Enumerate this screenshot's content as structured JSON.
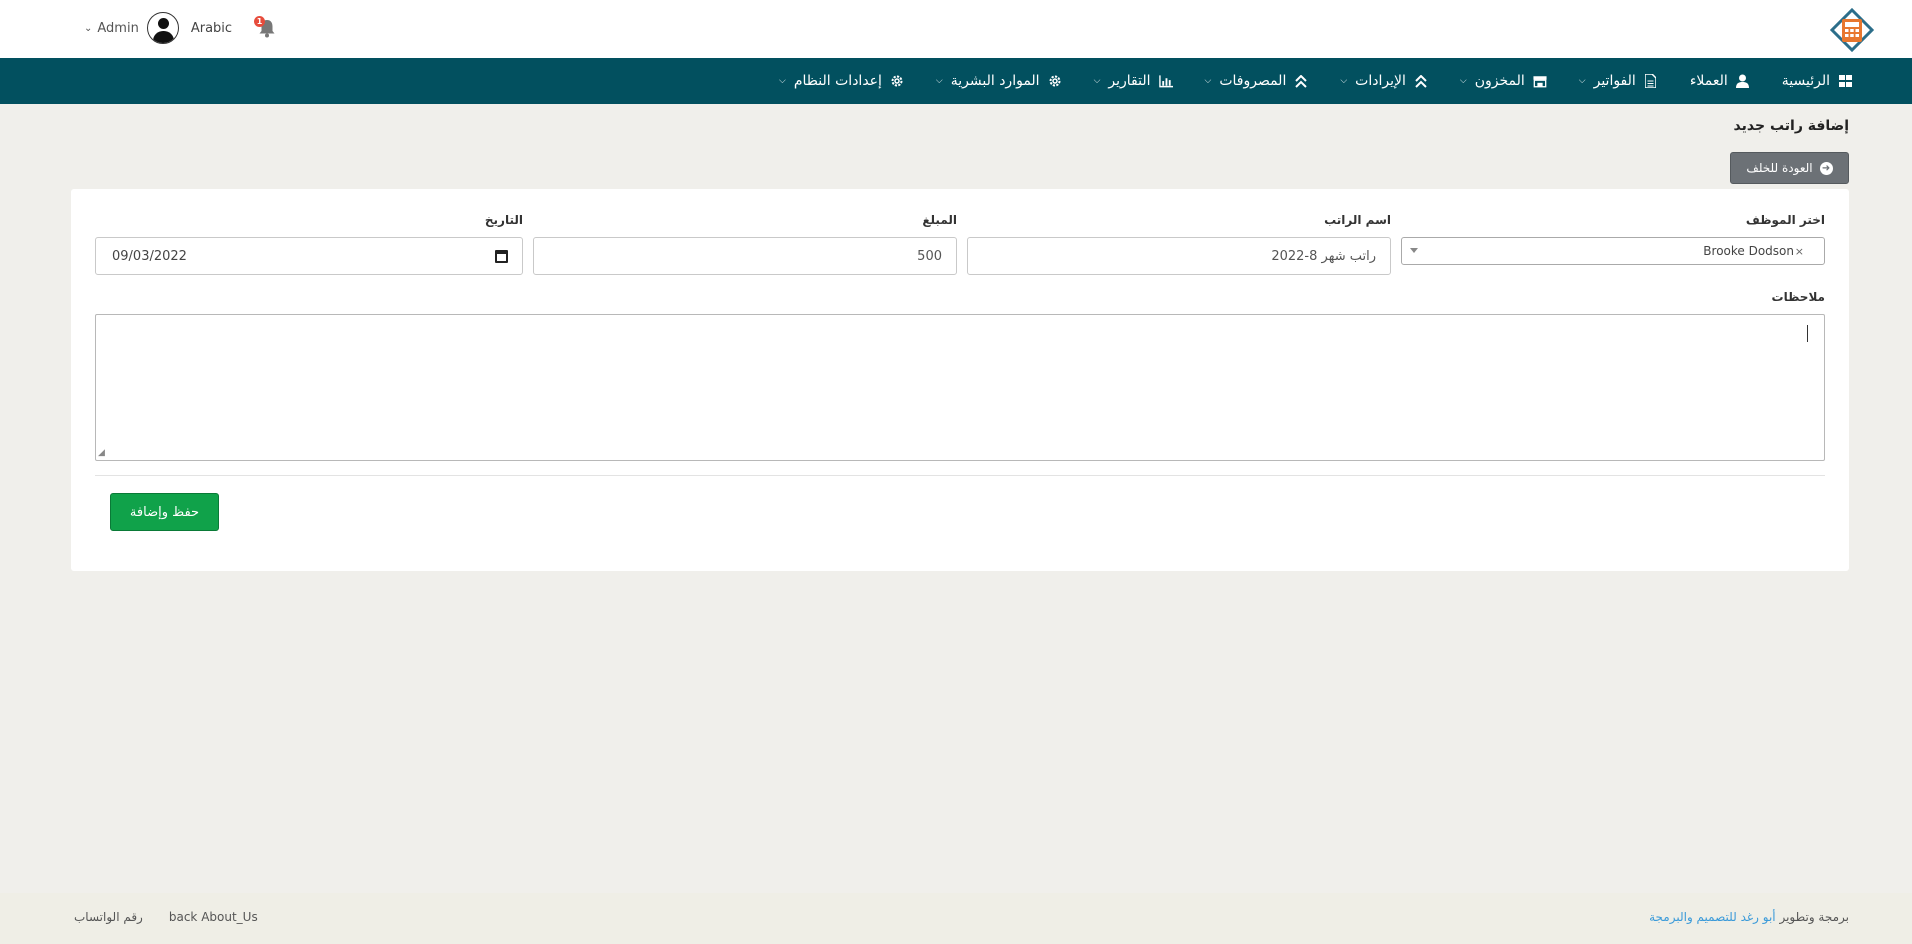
{
  "header": {
    "language": "Arabic",
    "user_name": "Admin",
    "notification_count": "1"
  },
  "nav": [
    {
      "label": "الرئيسية",
      "icon": "dashboard-icon",
      "has_dropdown": false
    },
    {
      "label": "العملاء",
      "icon": "user-icon",
      "has_dropdown": false
    },
    {
      "label": "الفواتير",
      "icon": "file-icon",
      "has_dropdown": true
    },
    {
      "label": "المخزون",
      "icon": "store-icon",
      "has_dropdown": true
    },
    {
      "label": "الإيرادات",
      "icon": "double-chevron-up-icon",
      "has_dropdown": true
    },
    {
      "label": "المصروفات",
      "icon": "double-chevron-up-icon",
      "has_dropdown": true
    },
    {
      "label": "التقارير",
      "icon": "chart-icon",
      "has_dropdown": true
    },
    {
      "label": "الموارد البشرية",
      "icon": "gear-icon",
      "has_dropdown": true
    },
    {
      "label": "إعدادات النظام",
      "icon": "gear-icon",
      "has_dropdown": true
    }
  ],
  "page": {
    "title": "إضافة راتب جديد",
    "back_label": "العودة للخلف"
  },
  "form": {
    "employee_label": "اختر الموظف",
    "employee_value": "Brooke Dodson",
    "salary_name_label": "اسم الراتب",
    "salary_name_value": "راتب شهر 8-2022",
    "amount_label": "المبلغ",
    "amount_value": "500",
    "date_label": "التاريخ",
    "date_value": "09/03/2022",
    "notes_label": "ملاحظات",
    "notes_value": "",
    "save_label": "حفظ وإضافة"
  },
  "footer": {
    "whatsapp": "رقم الواتساب",
    "about": "back About_Us",
    "credit_prefix": "برمجة وتطوير",
    "credit_link": "أبو رغد للتصميم والبرمجة"
  },
  "colors": {
    "nav_bg": "#02505f",
    "save_button": "#10a24a",
    "back_button": "#6c7176",
    "link": "#3a9ad9"
  }
}
